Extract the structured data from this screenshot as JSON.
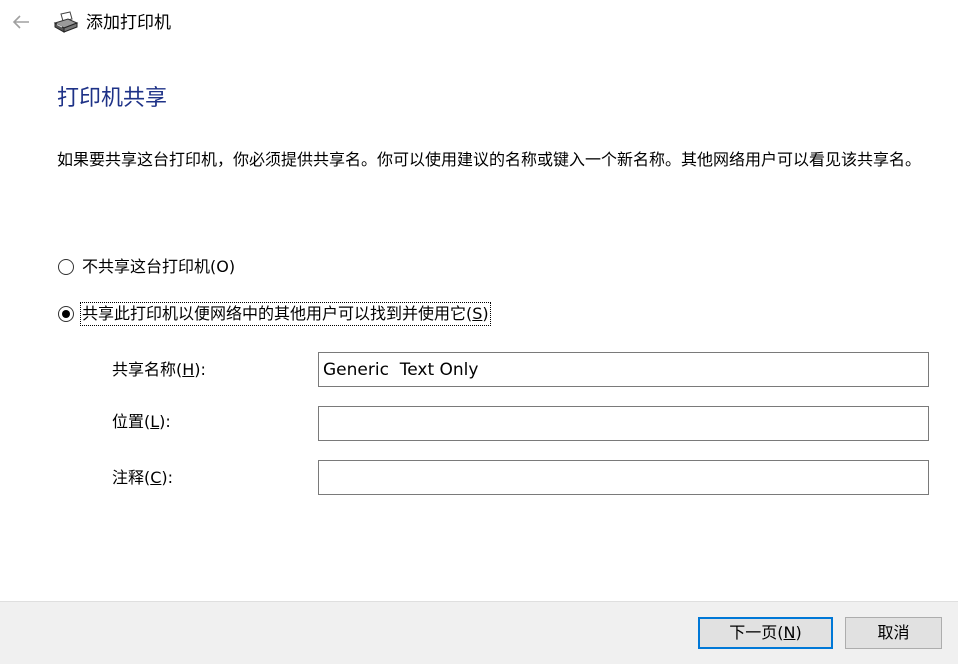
{
  "header": {
    "title": "添加打印机",
    "back_icon": "arrow-left-icon",
    "printer_icon": "printer-icon"
  },
  "main": {
    "title": "打印机共享",
    "description": "如果要共享这台打印机，你必须提供共享名。你可以使用建议的名称或键入一个新名称。其他网络用户可以看见该共享名。",
    "options": [
      {
        "label_pre": "不共享这台打印机(",
        "mnemonic": "O",
        "label_post": ")",
        "selected": false
      },
      {
        "label_pre": "共享此打印机以便网络中的其他用户可以找到并使用它(",
        "mnemonic": "S",
        "label_post": ")",
        "selected": true
      }
    ],
    "fields": [
      {
        "label_pre": "共享名称(",
        "mnemonic": "H",
        "label_post": "):",
        "value": "Generic  Text Only"
      },
      {
        "label_pre": "位置(",
        "mnemonic": "L",
        "label_post": "):",
        "value": ""
      },
      {
        "label_pre": "注释(",
        "mnemonic": "C",
        "label_post": "):",
        "value": ""
      }
    ]
  },
  "footer": {
    "next_pre": "下一页(",
    "next_mnemonic": "N",
    "next_post": ")",
    "cancel_label": "取消"
  },
  "colors": {
    "title": "#1e3287",
    "button_focus": "#0078d7",
    "footer_bg": "#f0f0f0"
  }
}
